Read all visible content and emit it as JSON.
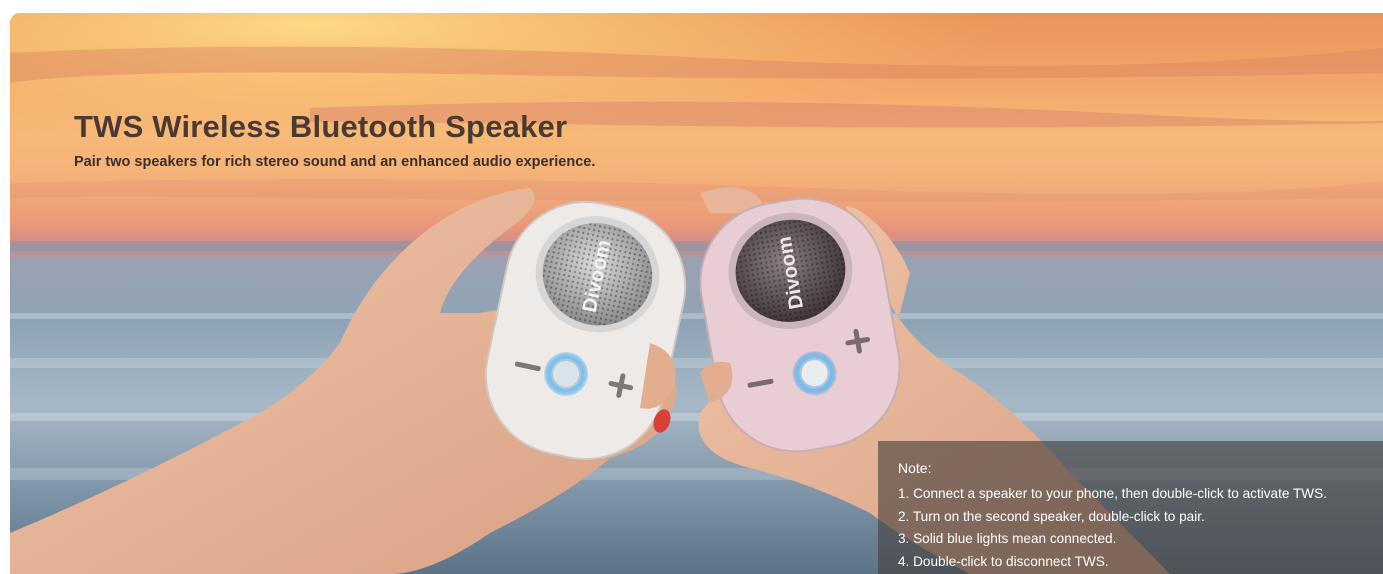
{
  "banner": {
    "title": "TWS Wireless Bluetooth Speaker",
    "subtitle": "Pair two speakers for rich stereo sound and an enhanced audio experience.",
    "brand_mark": "Divoom",
    "note": {
      "title": "Note:",
      "items": [
        "1. Connect a speaker to your phone, then double-click to activate TWS.",
        "2. Turn on the second speaker, double-click to pair.",
        "3. Solid blue lights mean connected.",
        "4. Double-click to disconnect TWS."
      ]
    }
  },
  "icons": {
    "speaker_left_play": "power-button-icon",
    "volume_down": "minus-icon",
    "volume_up": "plus-icon"
  },
  "colors": {
    "sky_top": "#f2a56a",
    "sky_glow": "#f7c27e",
    "sea": "#8ea4b6",
    "title": "#4a3a33",
    "speaker_white": "#eeeae8",
    "speaker_pink": "#e8ced4",
    "led_blue": "#3aa8f0",
    "note_bg": "#46403e"
  }
}
